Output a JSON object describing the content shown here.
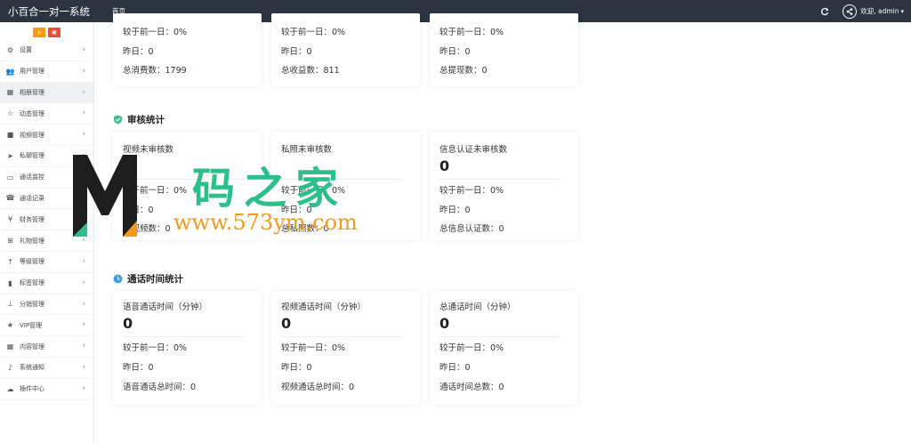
{
  "header": {
    "brand": "小百合一对一系统",
    "nav_home": "首页",
    "welcome": "欢迎, admin",
    "bg_color": "#2a3540"
  },
  "sidebar": {
    "items": [
      {
        "label": "设置",
        "icon": "gears-icon"
      },
      {
        "label": "用户管理",
        "icon": "users-icon"
      },
      {
        "label": "相册管理",
        "icon": "image-icon",
        "active": true
      },
      {
        "label": "动态管理",
        "icon": "star-icon"
      },
      {
        "label": "视频管理",
        "icon": "video-icon"
      },
      {
        "label": "私聊管理",
        "icon": "send-icon"
      },
      {
        "label": "通话监控",
        "icon": "monitor-icon"
      },
      {
        "label": "通话记录",
        "icon": "phone-icon"
      },
      {
        "label": "财务管理",
        "icon": "yen-icon"
      },
      {
        "label": "礼物管理",
        "icon": "gift-icon"
      },
      {
        "label": "等级管理",
        "icon": "level-icon"
      },
      {
        "label": "标签管理",
        "icon": "bookmark-icon"
      },
      {
        "label": "分销管理",
        "icon": "sitemap-icon"
      },
      {
        "label": "VIP管理",
        "icon": "star-filled-icon"
      },
      {
        "label": "内容管理",
        "icon": "grid-icon"
      },
      {
        "label": "系统通知",
        "icon": "bell-icon"
      },
      {
        "label": "插件中心",
        "icon": "cloud-icon"
      }
    ]
  },
  "top_cards": [
    {
      "compare": "较于前一日：0%",
      "yesterday": "昨日：0",
      "total": "总消费数：1799"
    },
    {
      "compare": "较于前一日：0%",
      "yesterday": "昨日：0",
      "total": "总收益数：811"
    },
    {
      "compare": "较于前一日：0%",
      "yesterday": "昨日：0",
      "total": "总提现数：0"
    }
  ],
  "audit": {
    "title": "审核统计",
    "cards": [
      {
        "label": "视频未审核数",
        "value": "",
        "compare": "较于前一日：0%",
        "yesterday": "昨日：0",
        "total": "总视频数：0"
      },
      {
        "label": "私照未审核数",
        "value": "",
        "compare": "较于前一日：0%",
        "yesterday": "昨日：0",
        "total": "总私照数：0"
      },
      {
        "label": "信息认证未审核数",
        "value": "0",
        "compare": "较于前一日：0%",
        "yesterday": "昨日：0",
        "total": "总信息认证数：0"
      }
    ]
  },
  "call": {
    "title": "通话时间统计",
    "cards": [
      {
        "label": "语音通话时间（分钟）",
        "value": "0",
        "compare": "较于前一日：0%",
        "yesterday": "昨日：0",
        "total": "语音通话总时间：0"
      },
      {
        "label": "视频通话时间（分钟）",
        "value": "0",
        "compare": "较于前一日：0%",
        "yesterday": "昨日：0",
        "total": "视频通话总时间：0"
      },
      {
        "label": "总通话时间（分钟）",
        "value": "0",
        "compare": "较于前一日：0%",
        "yesterday": "昨日：0",
        "total": "通话时间总数：0"
      }
    ]
  },
  "watermark": {
    "brand": "码之家",
    "url": "www.573ym.com",
    "green": "#2bbf8a",
    "orange": "#f39a1e"
  }
}
